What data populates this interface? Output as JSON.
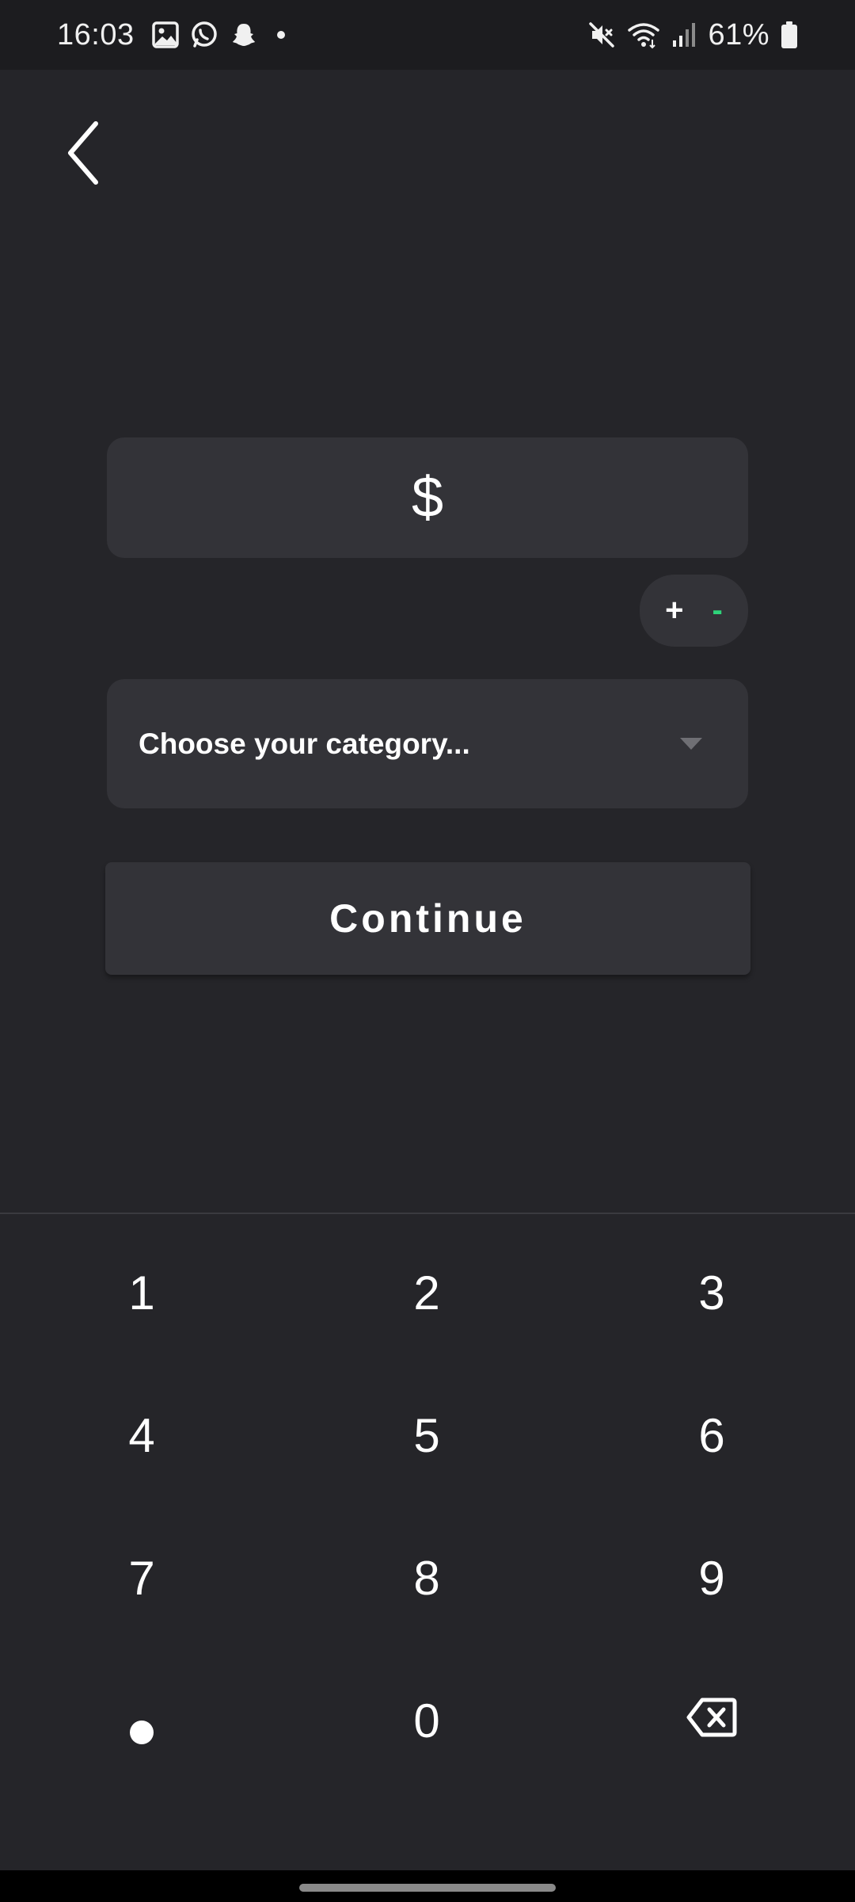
{
  "status_bar": {
    "time": "16:03",
    "battery_percent": "61%",
    "left_icons": [
      "gallery-icon",
      "whatsapp-icon",
      "snapchat-icon",
      "notification-dot-icon"
    ],
    "right_icons": [
      "mute-icon",
      "wifi-icon",
      "signal-icon",
      "battery-icon"
    ]
  },
  "header": {
    "back_icon": "chevron-left-icon"
  },
  "amount": {
    "currency_symbol": "$"
  },
  "sign_toggle": {
    "plus": "+",
    "minus": "-",
    "minus_color": "#2ed47a"
  },
  "category": {
    "placeholder": "Choose your category...",
    "dropdown_icon": "caret-down-icon"
  },
  "continue_button": {
    "label": "Continue"
  },
  "keypad": {
    "keys": [
      "1",
      "2",
      "3",
      "4",
      "5",
      "6",
      "7",
      "8",
      "9"
    ],
    "zero": "0",
    "decimal_icon": "decimal-dot-icon",
    "backspace_icon": "backspace-icon"
  },
  "colors": {
    "background": "#252529",
    "surface": "#333338",
    "accent_green": "#2ed47a"
  }
}
